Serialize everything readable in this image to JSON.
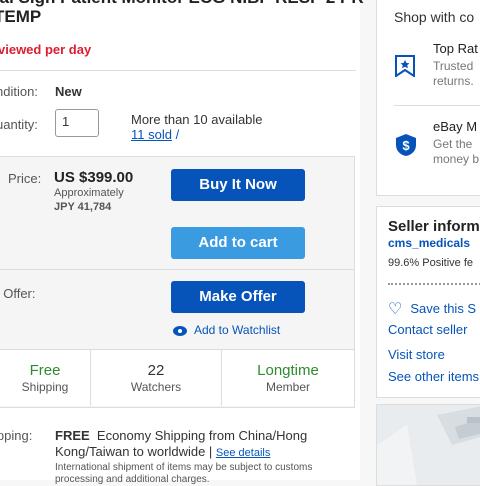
{
  "listing": {
    "title": "tal Sign Patient Monitor ECG NIBP RESP 2 PR TEMP",
    "views": "viewed per day"
  },
  "details": {
    "condition_label": "ndition:",
    "condition_value": "New",
    "quantity_label": "uantity:",
    "quantity_value": "1",
    "available": "More than 10 available",
    "sold": "11 sold",
    "sold_suffix": "/"
  },
  "price": {
    "label": "Price:",
    "amount": "US $399.00",
    "approx_label": "Approximately",
    "converted": "JPY 41,784"
  },
  "actions": {
    "buy_now": "Buy It Now",
    "add_to_cart": "Add to cart",
    "best_offer_label": "t Offer:",
    "make_offer": "Make Offer",
    "add_watchlist": "Add to Watchlist"
  },
  "stats": [
    {
      "value": "Free",
      "label": "Shipping"
    },
    {
      "value": "22",
      "label": "Watchers"
    },
    {
      "value": "Longtime",
      "label": "Member"
    }
  ],
  "shipping": {
    "label": "ipping:",
    "free": "FREE",
    "method": "Economy Shipping from China/Hong Kong/Taiwan to worldwide |",
    "see_details": "See details",
    "note": "International shipment of items may be subject to customs processing and additional charges."
  },
  "sidebar": {
    "shop_with": "Shop with co",
    "top_rated_title": "Top Rat",
    "top_rated_line1": "Trusted",
    "top_rated_line2": "returns.",
    "ebay_title": "eBay M",
    "ebay_line1": "Get the",
    "ebay_line2": "money b"
  },
  "seller": {
    "heading": "Seller inform",
    "name": "cms_medicals",
    "feedback": "99.6% Positive fe",
    "save": "Save this S",
    "contact": "Contact seller",
    "visit": "Visit store",
    "see_other": "See other items"
  },
  "colors": {
    "primary_blue": "#0654ba",
    "cart_blue": "#3b9be1",
    "alert_red": "#dd1e31",
    "green": "#2e8b2e"
  }
}
